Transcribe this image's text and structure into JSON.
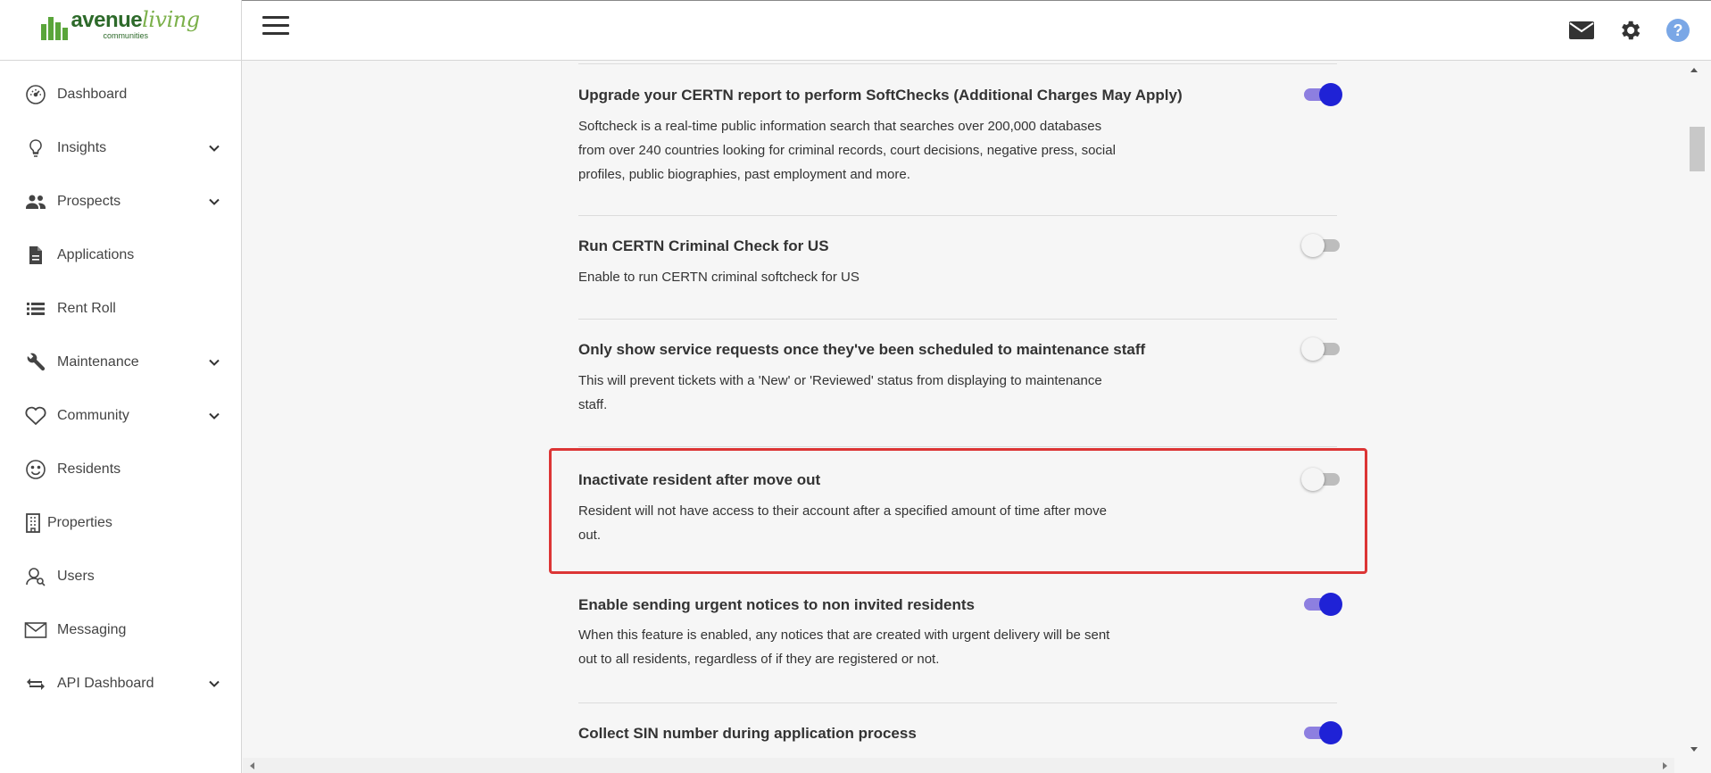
{
  "app": {
    "logo_main": "avenue",
    "logo_living": "living",
    "logo_sub": "communities"
  },
  "sidebar": {
    "items": [
      {
        "label": "Dashboard",
        "icon": "speedometer-icon",
        "expandable": false
      },
      {
        "label": "Insights",
        "icon": "lightbulb-icon",
        "expandable": true
      },
      {
        "label": "Prospects",
        "icon": "people-icon",
        "expandable": true
      },
      {
        "label": "Applications",
        "icon": "document-icon",
        "expandable": false
      },
      {
        "label": "Rent Roll",
        "icon": "list-icon",
        "expandable": false
      },
      {
        "label": "Maintenance",
        "icon": "wrench-icon",
        "expandable": true
      },
      {
        "label": "Community",
        "icon": "heart-icon",
        "expandable": true
      },
      {
        "label": "Residents",
        "icon": "smiley-icon",
        "expandable": false
      },
      {
        "label": "Properties",
        "icon": "building-icon",
        "expandable": false
      },
      {
        "label": "Users",
        "icon": "user-icon",
        "expandable": false
      },
      {
        "label": "Messaging",
        "icon": "envelope-icon",
        "expandable": false
      },
      {
        "label": "API Dashboard",
        "icon": "swap-arrows-icon",
        "expandable": true
      }
    ]
  },
  "topbar": {
    "icons": [
      "mail-icon",
      "gear-icon",
      "help-icon"
    ]
  },
  "settings": [
    {
      "title": "Upgrade your CERTN report to perform SoftChecks (Additional Charges May Apply)",
      "description": "Softcheck is a real-time public information search that searches over 200,000 databases from over 240 countries looking for criminal records, court decisions, negative press, social profiles, public biographies, past employment and more.",
      "enabled": true
    },
    {
      "title": "Run CERTN Criminal Check for US",
      "description": "Enable to run CERTN criminal softcheck for US",
      "enabled": false
    },
    {
      "title": "Only show service requests once they've been scheduled to maintenance staff",
      "description": "This will prevent tickets with a 'New' or 'Reviewed' status from displaying to maintenance staff.",
      "enabled": false
    },
    {
      "title": "Inactivate resident after move out",
      "description": "Resident will not have access to their account after a specified amount of time after move out.",
      "enabled": false,
      "highlighted": true
    },
    {
      "title": "Enable sending urgent notices to non invited residents",
      "description": "When this feature is enabled, any notices that are created with urgent delivery will be sent out to all residents, regardless of if they are registered or not.",
      "enabled": true
    },
    {
      "title": "Collect SIN number during application process",
      "description": "",
      "enabled": true
    }
  ],
  "colors": {
    "toggle_on_knob": "#1f22d6",
    "toggle_on_track": "#8d7fe0",
    "highlight_border": "#dc3535",
    "logo_green": "#5aa53a",
    "help_icon": "#7aa7e6"
  }
}
